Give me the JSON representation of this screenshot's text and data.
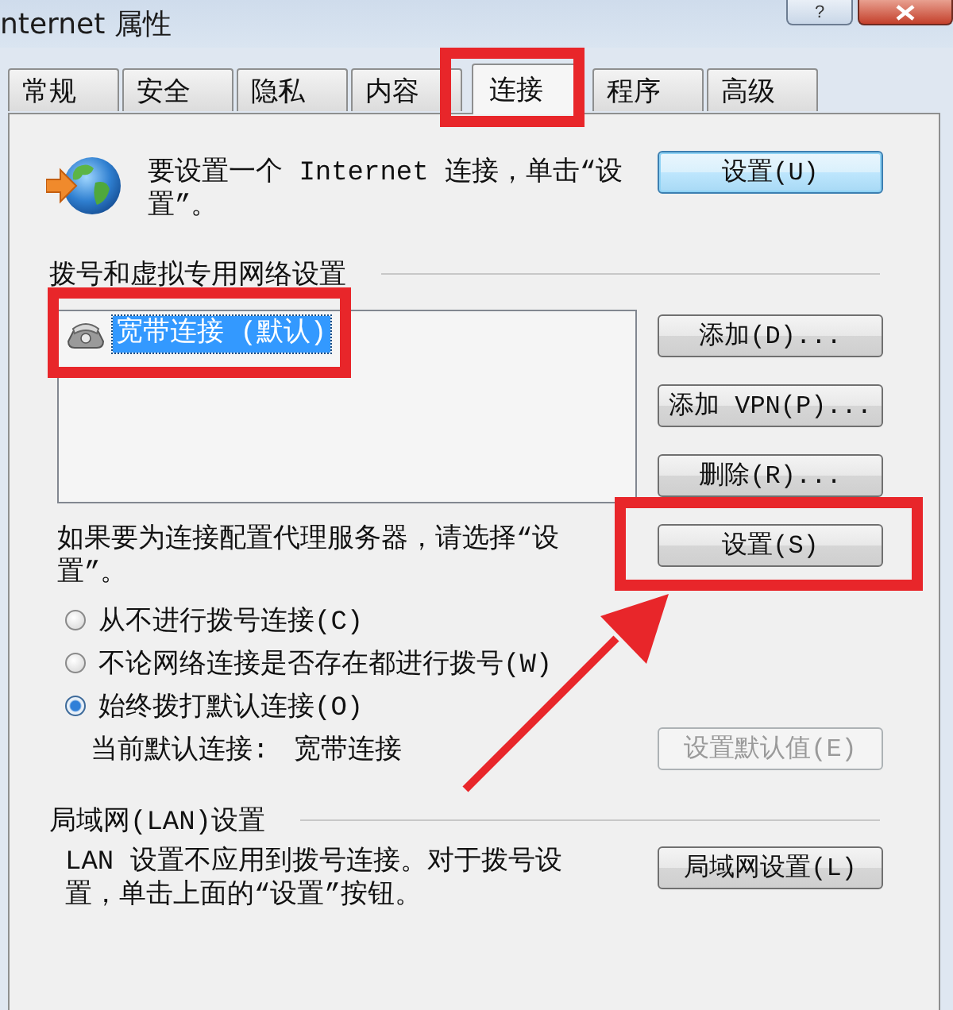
{
  "window": {
    "title": "nternet 属性",
    "help_button": "?"
  },
  "tabs": [
    {
      "label": "常规",
      "selected": false
    },
    {
      "label": "安全",
      "selected": false
    },
    {
      "label": "隐私",
      "selected": false
    },
    {
      "label": "内容",
      "selected": false
    },
    {
      "label": "连接",
      "selected": true
    },
    {
      "label": "程序",
      "selected": false
    },
    {
      "label": "高级",
      "selected": false
    }
  ],
  "internet_setup": {
    "text": "要设置一个 Internet 连接，单击“设置”。",
    "button": {
      "label": "设置(U)",
      "default": true
    }
  },
  "dialup_vpn": {
    "heading": "拨号和虚拟专用网络设置",
    "connections": [
      {
        "label": "宽带连接 (默认)",
        "selected": true
      }
    ],
    "buttons": [
      "添加(D)...",
      "添加 VPN(P)...",
      "删除(R)..."
    ]
  },
  "proxy": {
    "text": "如果要为连接配置代理服务器，请选择“设置”。",
    "button": {
      "label": "设置(S)",
      "default": false
    }
  },
  "dial_options": [
    {
      "label": "从不进行拨号连接(C)",
      "selected": false
    },
    {
      "label": "不论网络连接是否存在都进行拨号(W)",
      "selected": false
    },
    {
      "label": "始终拨打默认连接(O)",
      "selected": true
    }
  ],
  "current_default": {
    "label": "当前默认连接:",
    "value": "宽带连接"
  },
  "set_default_button": {
    "label": "设置默认值(E)",
    "disabled": true
  },
  "lan": {
    "heading": "局域网(LAN)设置",
    "text": "LAN 设置不应用到拨号连接。对于拨号设置，单击上面的“设置”按钮。",
    "button": {
      "label": "局域网设置(L)",
      "default": false
    }
  }
}
